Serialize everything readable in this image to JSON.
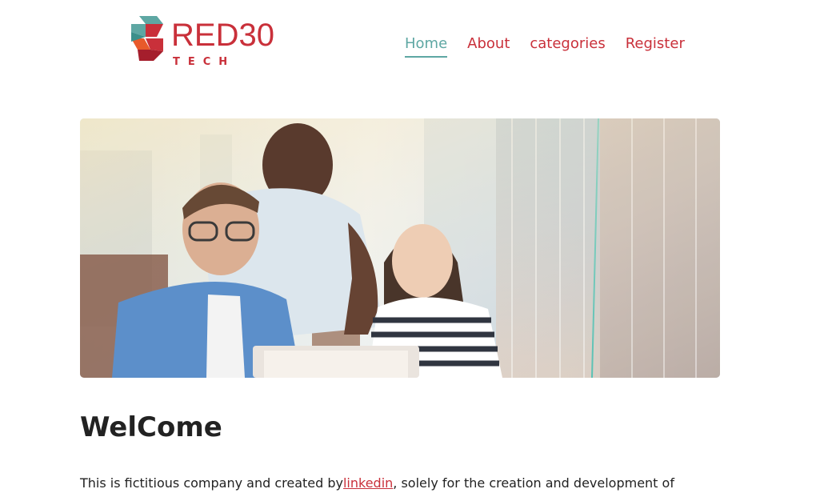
{
  "brand": {
    "name": "RED30",
    "subtitle": "TECH",
    "colors": {
      "red": "#c9303a",
      "teal": "#5ea7a3"
    }
  },
  "nav": {
    "items": [
      {
        "label": "Home",
        "active": true
      },
      {
        "label": "About",
        "active": false
      },
      {
        "label": "categories",
        "active": false
      },
      {
        "label": "Register",
        "active": false
      }
    ]
  },
  "hero": {
    "icon": "team-photo-image"
  },
  "main": {
    "heading": "WelCome",
    "intro_before": "This is fictitious company and created by",
    "intro_link": "linkedin",
    "intro_after": ", solely for the creation and development of"
  }
}
